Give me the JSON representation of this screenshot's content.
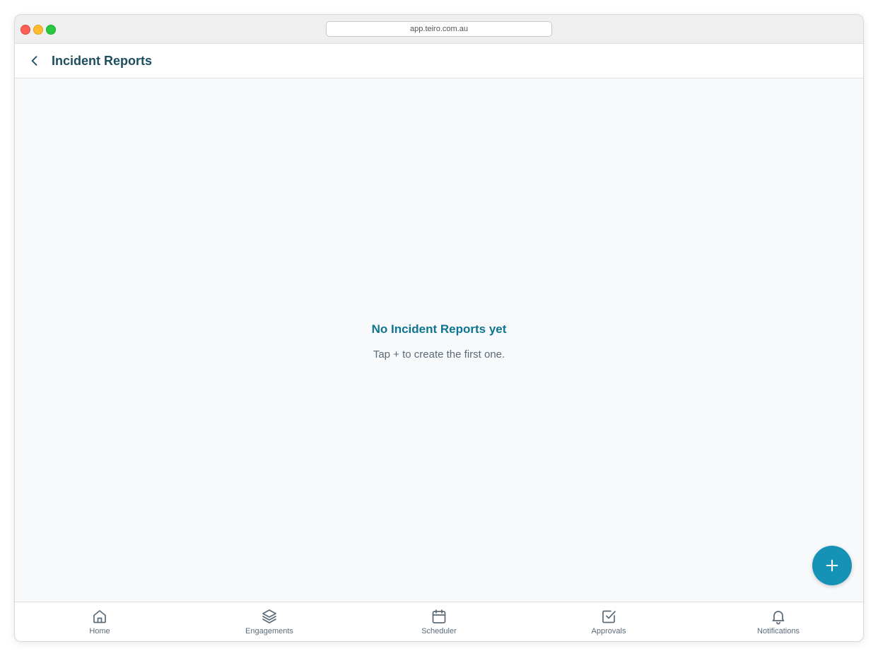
{
  "browser": {
    "url": "app.teiro.com.au"
  },
  "header": {
    "title": "Incident Reports",
    "back_icon": "chevron-left-icon"
  },
  "empty_state": {
    "title": "No Incident Reports yet",
    "subtitle": "Tap + to create the first one."
  },
  "fab": {
    "icon": "plus-icon"
  },
  "tabbar": {
    "items": [
      {
        "label": "Home",
        "icon": "home-icon"
      },
      {
        "label": "Engagements",
        "icon": "layers-icon"
      },
      {
        "label": "Scheduler",
        "icon": "calendar-icon"
      },
      {
        "label": "Approvals",
        "icon": "checkbox-icon"
      },
      {
        "label": "Notifications",
        "icon": "bell-icon"
      }
    ]
  },
  "colors": {
    "accent": "#1592b5",
    "title_text": "#1d4e5f",
    "empty_title": "#0e7490",
    "muted_text": "#5b6b78",
    "content_bg": "#f7f9fb"
  }
}
